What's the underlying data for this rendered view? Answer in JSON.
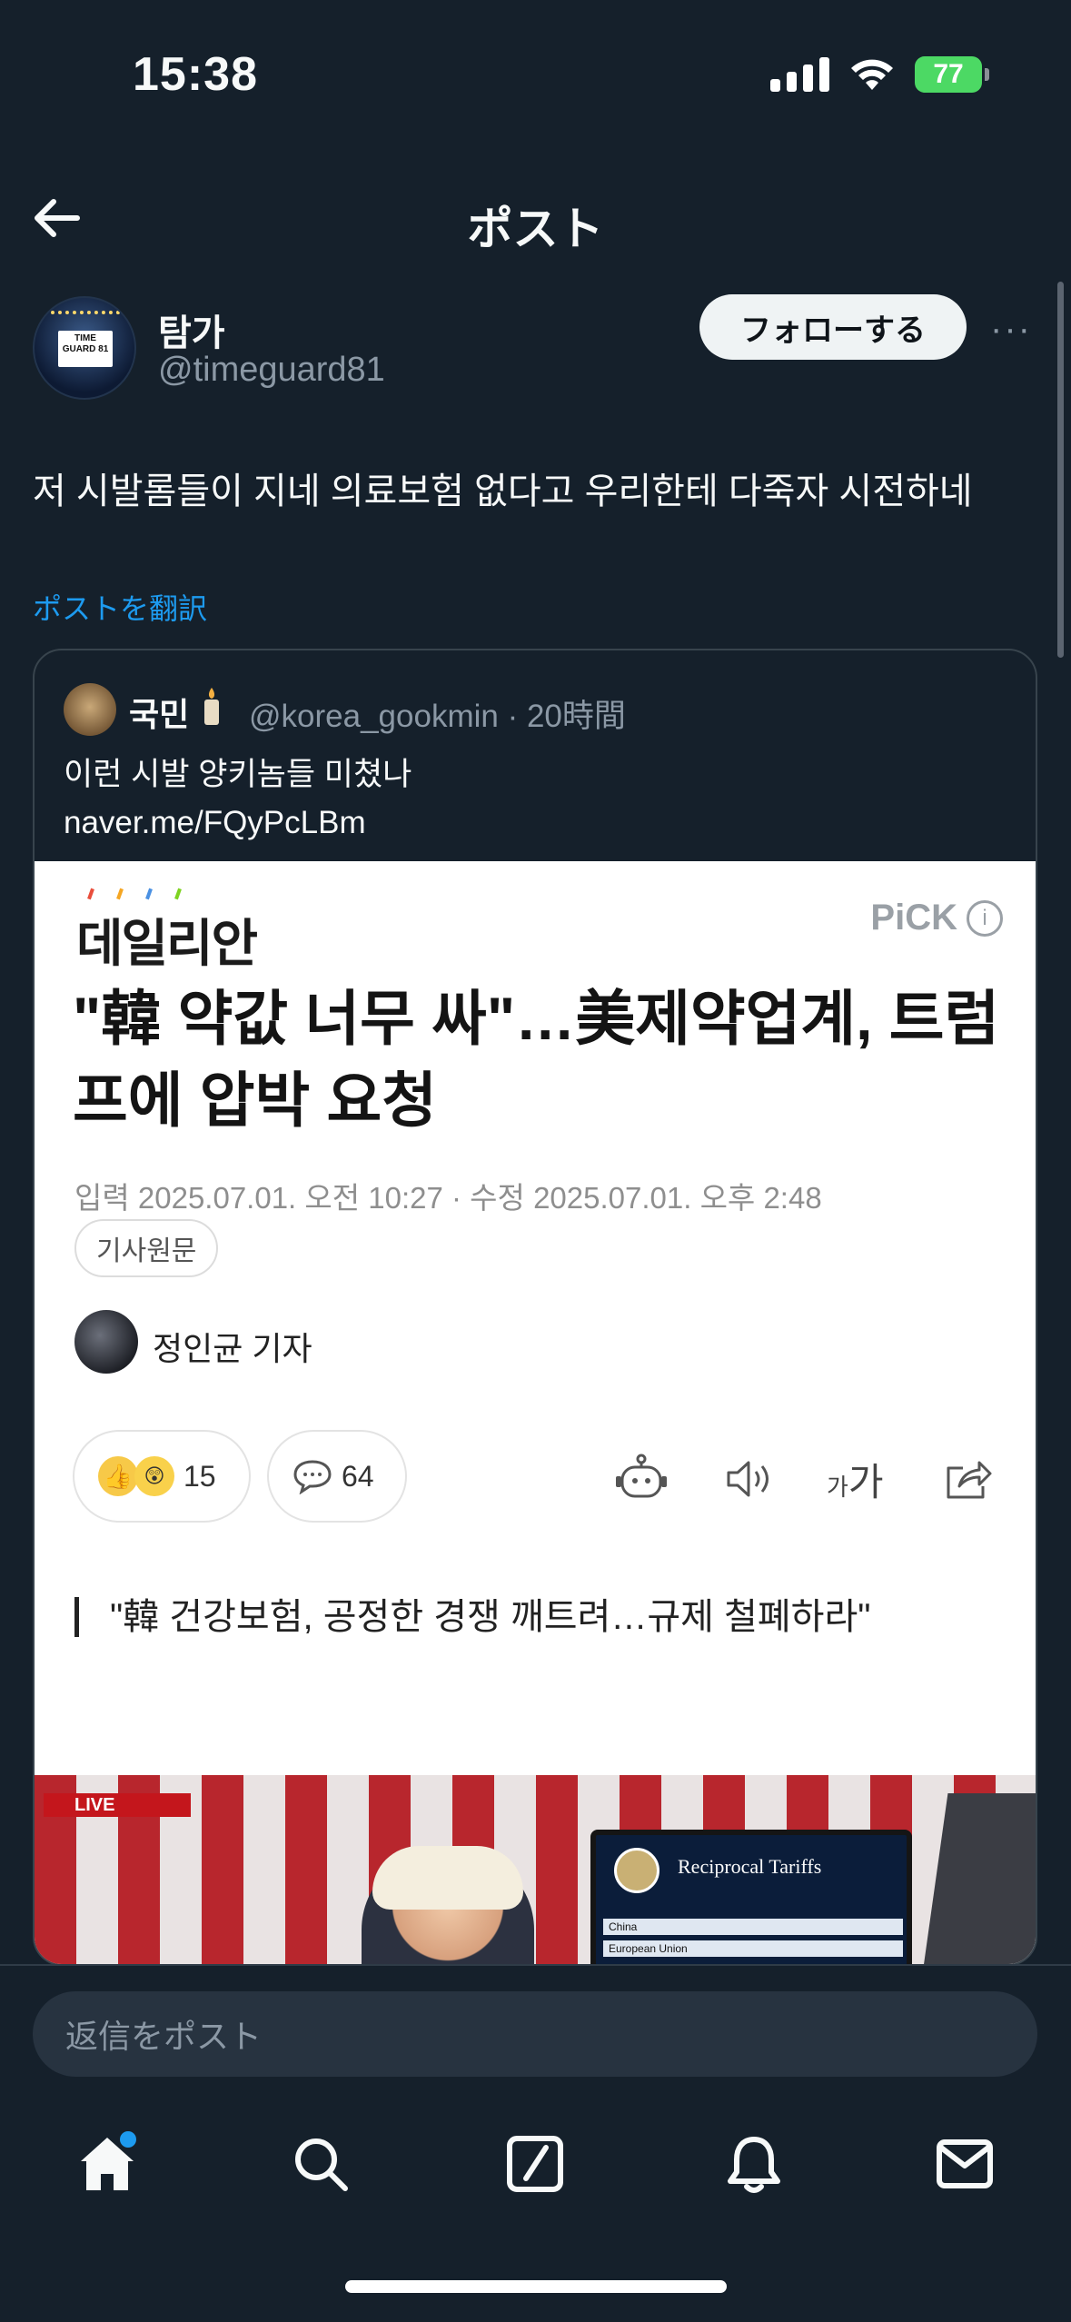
{
  "status_bar": {
    "time": "15:38",
    "battery": "77"
  },
  "header": {
    "title": "ポスト"
  },
  "author": {
    "display_name": "탐가",
    "handle": "@timeguard81",
    "avatar_text": "TIME GUARD 81"
  },
  "actions": {
    "follow_label": "フォローする",
    "more": "···"
  },
  "post": {
    "text": "저 시발롬들이 지네 의료보험 없다고 우리한테 다죽자 시전하네",
    "translate_label": "ポストを翻訳"
  },
  "quote": {
    "name": "국민",
    "handle_time": "@korea_gookmin · 20時間",
    "text": "이런 시발 양키놈들 미쳤나\nnaver.me/FQyPcLBm"
  },
  "article": {
    "publisher": "데일리안",
    "pick_label": "PiCK",
    "headline": "\"韓 약값 너무 싸\"…美제약업계, 트럼프에 압박 요청",
    "dates": "입력 2025.07.01. 오전 10:27 · 수정 2025.07.01. 오후 2:48",
    "source_tag": "기사원문",
    "reporter": "정인균 기자",
    "like_count": "15",
    "comment_count": "64",
    "font_label_small": "가",
    "font_label_large": "가",
    "subheadline": "\"韓 건강보험, 공정한 경쟁 깨트려…규제 철폐하라\"",
    "photo": {
      "live_badge": "LIVE",
      "board_title": "Reciprocal Tariffs",
      "board_rows": [
        "China",
        "European Union"
      ]
    }
  },
  "reply": {
    "placeholder": "返信をポスト"
  },
  "tabbar": {
    "items": [
      "home",
      "search",
      "grok",
      "notifications",
      "messages"
    ]
  },
  "colors": {
    "background": "#15202b",
    "accent": "#1d9bf0",
    "muted": "#8b98a5"
  }
}
